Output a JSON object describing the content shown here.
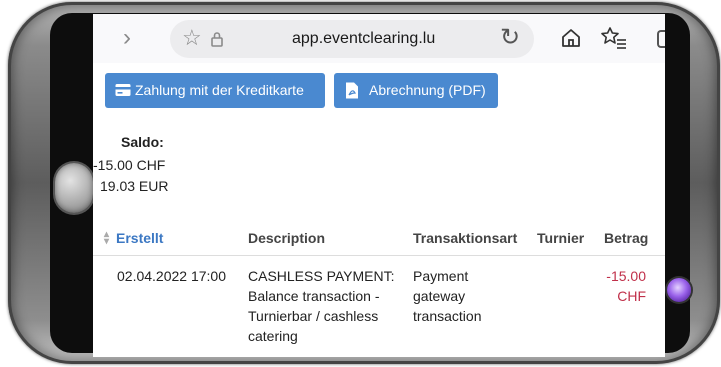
{
  "browser": {
    "url": "app.eventclearing.lu",
    "icons": [
      "forward-icon",
      "bookmark-star-icon",
      "lock-icon",
      "reload-icon",
      "home-icon",
      "favorites-icon"
    ]
  },
  "actions": {
    "card_button": "Zahlung mit der Kreditkarte",
    "pdf_button": "Abrechnung (PDF)",
    "accent": "#4a89d0"
  },
  "saldo": {
    "label": "Saldo:",
    "values": [
      "-15.00 CHF",
      "19.03 EUR"
    ]
  },
  "table": {
    "columns": [
      "Erstellt",
      "Description",
      "Transaktionsart",
      "Turnier",
      "Betrag"
    ],
    "rows": [
      {
        "created": "02.04.2022 17:00",
        "description": [
          "CASHLESS PAYMENT:",
          "Balance transaction -",
          "Turnierbar / cashless",
          "catering"
        ],
        "type": [
          "Payment",
          "gateway",
          "transaction"
        ],
        "tournament": "",
        "amount": [
          "-15.00",
          "CHF"
        ]
      }
    ],
    "negative_color": "#c0304a"
  }
}
